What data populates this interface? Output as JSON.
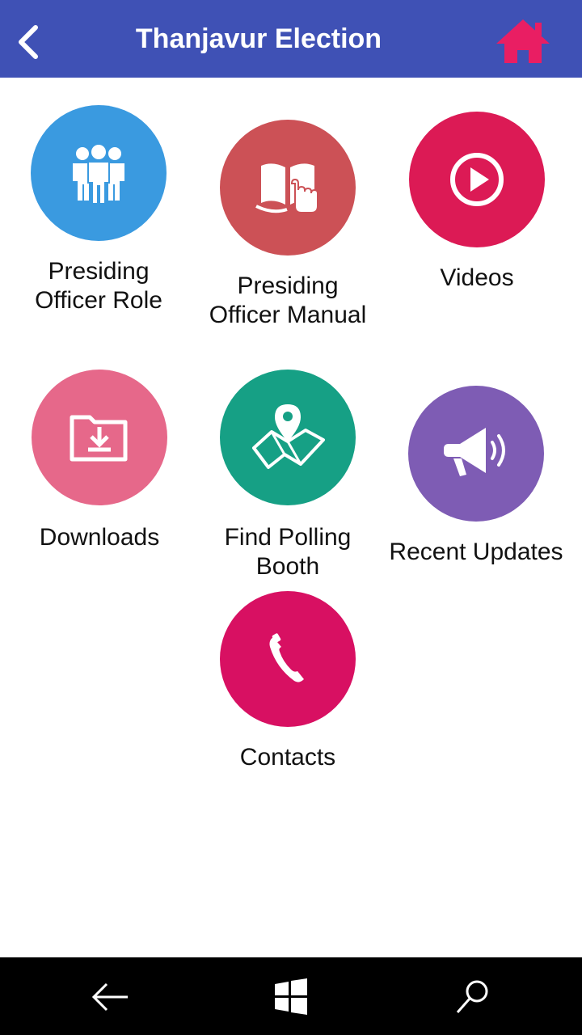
{
  "header": {
    "title": "Thanjavur Election",
    "back_icon": "chevron-left-icon",
    "home_icon": "home-icon",
    "background": "#3f51b5",
    "home_color": "#e91e63"
  },
  "menu": [
    {
      "label": "Presiding\nOfficer Role",
      "icon": "group-icon",
      "color": "#3a9ae0"
    },
    {
      "label": "Presiding\nOfficer Manual",
      "icon": "book-touch-icon",
      "color": "#cc5156"
    },
    {
      "label": "Videos",
      "icon": "play-icon",
      "color": "#dc1a55"
    },
    {
      "label": "Downloads",
      "icon": "folder-download-icon",
      "color": "#e6688a"
    },
    {
      "label": "Find Polling\nBooth",
      "icon": "map-pin-icon",
      "color": "#16a085"
    },
    {
      "label": "Recent Updates",
      "icon": "megaphone-icon",
      "color": "#7e5cb4"
    },
    {
      "label": "Contacts",
      "icon": "phone-icon",
      "color": "#d81062"
    }
  ],
  "navbar": {
    "back_icon": "arrow-left-icon",
    "start_icon": "windows-icon",
    "search_icon": "search-icon"
  }
}
